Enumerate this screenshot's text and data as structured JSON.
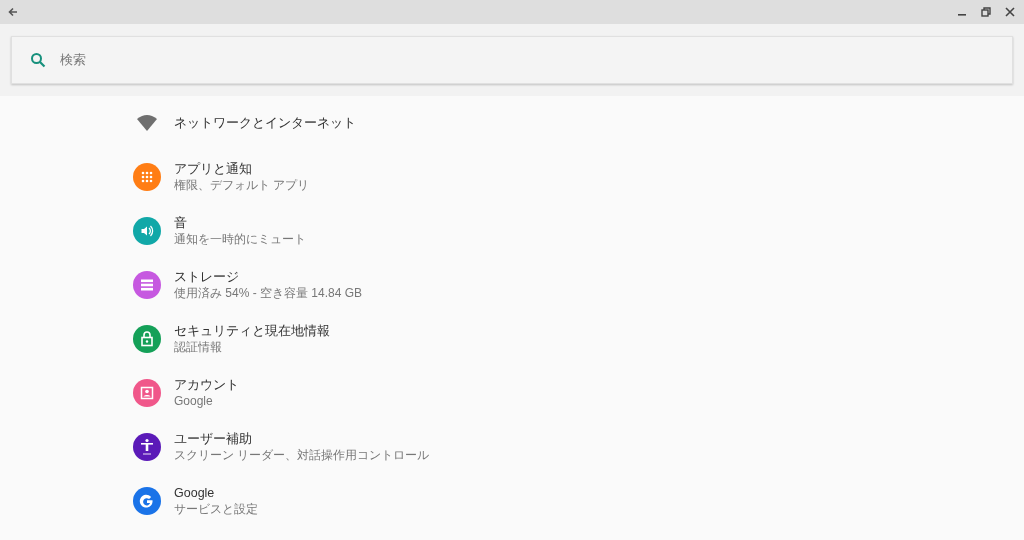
{
  "search": {
    "placeholder": "検索"
  },
  "items": [
    {
      "kind": "wifi",
      "title": "ネットワークとインターネット"
    },
    {
      "kind": "apps",
      "color": "#ff7d14",
      "title": "アプリと通知",
      "subtitle": "権限、デフォルト アプリ"
    },
    {
      "kind": "sound",
      "color": "#11a8a8",
      "title": "音",
      "subtitle": "通知を一時的にミュート"
    },
    {
      "kind": "storage",
      "color": "#c658e0",
      "title": "ストレージ",
      "subtitle": "使用済み 54% - 空き容量 14.84 GB"
    },
    {
      "kind": "lock",
      "color": "#14a058",
      "title": "セキュリティと現在地情報",
      "subtitle": "認証情報"
    },
    {
      "kind": "account",
      "color": "#f0578a",
      "title": "アカウント",
      "subtitle": "Google"
    },
    {
      "kind": "accessibility",
      "color": "#5b1ab8",
      "title": "ユーザー補助",
      "subtitle": "スクリーン リーダー、対話操作用コントロール"
    },
    {
      "kind": "google",
      "color": "#1a73e8",
      "title": "Google",
      "subtitle": "サービスと設定"
    }
  ]
}
